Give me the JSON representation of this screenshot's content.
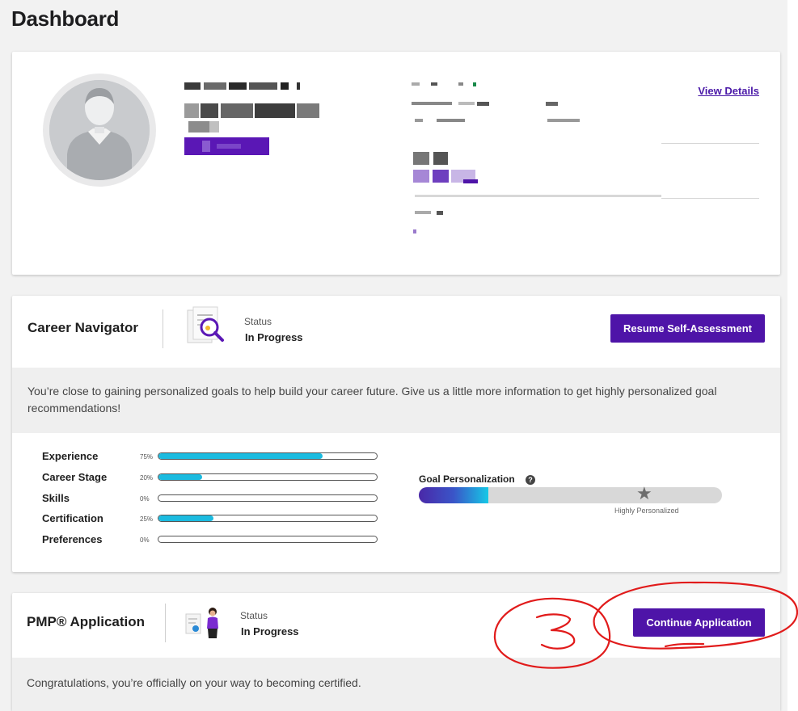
{
  "page": {
    "title": "Dashboard"
  },
  "profile": {
    "view_details_label": "View Details"
  },
  "career_navigator": {
    "title": "Career Navigator",
    "status_label": "Status",
    "status_value": "In Progress",
    "button_label": "Resume Self-Assessment",
    "message": "You’re close to gaining personalized goals to help build your career future. Give us a little more information to get highly personalized goal recommendations!",
    "metrics": [
      {
        "label": "Experience",
        "percent_text": "75%",
        "value": 75
      },
      {
        "label": "Career Stage",
        "percent_text": "20%",
        "value": 20
      },
      {
        "label": "Skills",
        "percent_text": "0%",
        "value": 0
      },
      {
        "label": "Certification",
        "percent_text": "25%",
        "value": 25
      },
      {
        "label": "Preferences",
        "percent_text": "0%",
        "value": 0
      }
    ],
    "goal": {
      "title": "Goal Personalization",
      "help_icon": "question-circle-icon",
      "progress": 0.23,
      "target_icon": "star-icon",
      "caption": "Highly Personalized"
    }
  },
  "pmp": {
    "title": "PMP® Application",
    "status_label": "Status",
    "status_value": "In Progress",
    "button_label": "Continue Application",
    "message": "Congratulations, you’re officially on your way to becoming certified."
  },
  "annotation": {
    "number": "3",
    "color": "#e11b1b"
  },
  "colors": {
    "accent": "#4e14a8",
    "progress": "#1bbbe0",
    "link": "#4b1aa8"
  }
}
